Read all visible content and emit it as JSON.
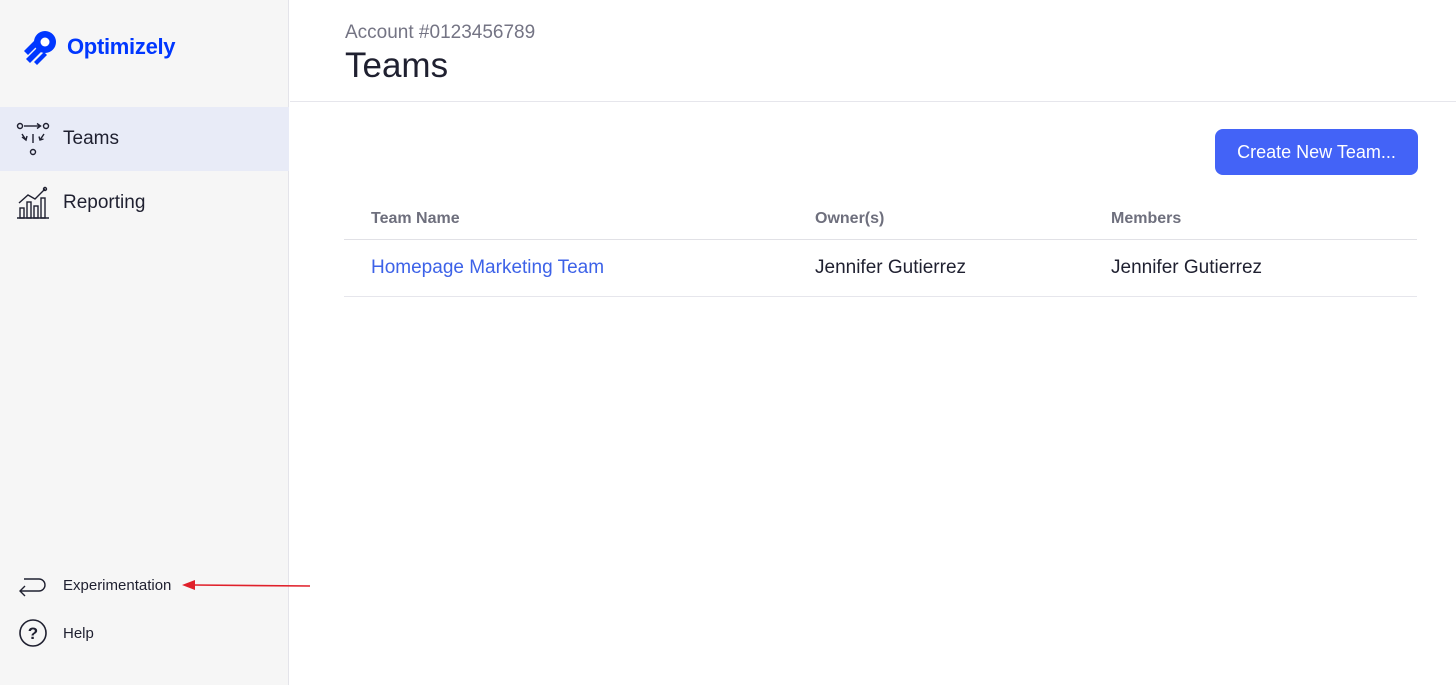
{
  "brand": {
    "name": "Optimizely",
    "color": "#0037ff"
  },
  "sidebar": {
    "items": [
      {
        "label": "Teams",
        "icon": "teams-flow-icon",
        "active": true
      },
      {
        "label": "Reporting",
        "icon": "reporting-chart-icon",
        "active": false
      }
    ],
    "bottom": [
      {
        "label": "Experimentation",
        "icon": "return-arrow-icon"
      },
      {
        "label": "Help",
        "icon": "help-circle-icon"
      }
    ]
  },
  "header": {
    "account": "Account #0123456789",
    "title": "Teams"
  },
  "actions": {
    "create_label": "Create New Team..."
  },
  "table": {
    "columns": [
      "Team Name",
      "Owner(s)",
      "Members"
    ],
    "rows": [
      {
        "team": "Homepage Marketing Team",
        "owners": "Jennifer Gutierrez",
        "members": "Jennifer Gutierrez"
      }
    ]
  },
  "colors": {
    "accent": "#4363f7",
    "link": "#3d62e8",
    "annotation": "#e0202a",
    "active_bg": "#e8ebf7"
  }
}
